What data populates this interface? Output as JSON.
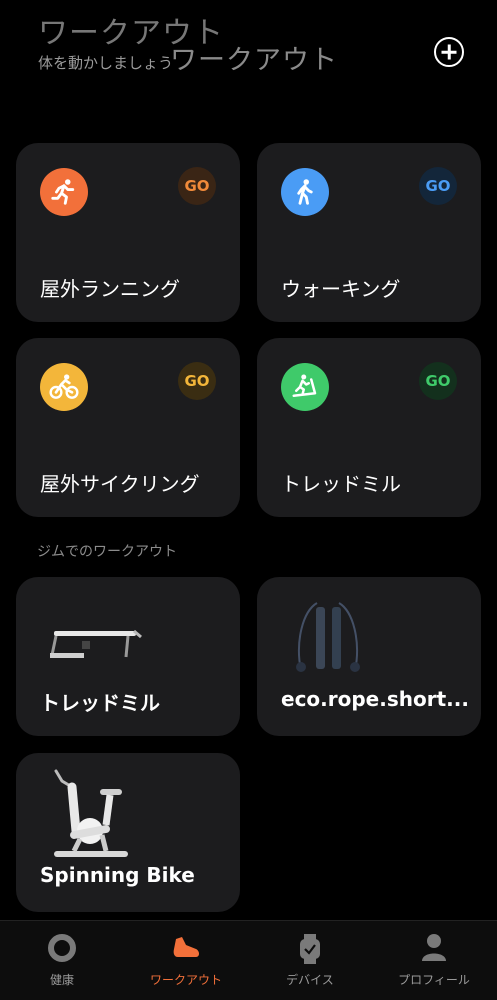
{
  "header": {
    "big_title": "ワークアウト",
    "subtitle": "体を動かしましょう",
    "overlay_title": "ワークアウト"
  },
  "workouts": [
    {
      "label": "屋外ランニング",
      "go": "GO",
      "icon": "running-icon",
      "color": "#f2703a",
      "go_bg": "#3a2515",
      "go_color": "#f08a3a"
    },
    {
      "label": "ウォーキング",
      "go": "GO",
      "icon": "walking-icon",
      "color": "#4a9cf5",
      "go_bg": "#13263a",
      "go_color": "#4a9cf5"
    },
    {
      "label": "屋外サイクリング",
      "go": "GO",
      "icon": "cycling-icon",
      "color": "#f3b63a",
      "go_bg": "#3a2d12",
      "go_color": "#f3b63a"
    },
    {
      "label": "トレッドミル",
      "go": "GO",
      "icon": "treadmill-icon",
      "color": "#3fca6a",
      "go_bg": "#13301d",
      "go_color": "#3fca6a"
    }
  ],
  "gym_section": {
    "label": "ジムでのワークアウト",
    "devices": [
      {
        "label": "トレッドミル",
        "image": "treadmill-device-image"
      },
      {
        "label": "eco.rope.short...",
        "image": "jump-rope-image"
      },
      {
        "label": "Spinning Bike",
        "image": "exercise-bike-image"
      }
    ]
  },
  "nav": [
    {
      "label": "健康",
      "icon": "health-ring-icon",
      "active": false
    },
    {
      "label": "ワークアウト",
      "icon": "shoe-icon",
      "active": true
    },
    {
      "label": "デバイス",
      "icon": "watch-icon",
      "active": false
    },
    {
      "label": "プロフィール",
      "icon": "profile-icon",
      "active": false
    }
  ],
  "colors": {
    "accent": "#f2703a",
    "card_bg": "#1c1c1e",
    "background": "#000000"
  }
}
